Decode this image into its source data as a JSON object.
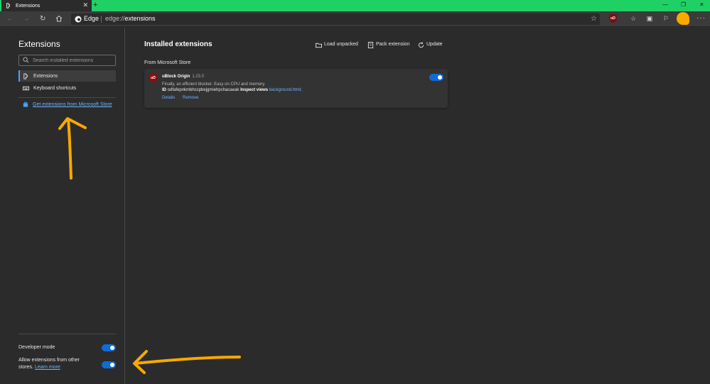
{
  "browser": {
    "tab_title": "Extensions",
    "newtab_symbol": "+",
    "close_symbol": "✕",
    "window_controls": [
      "—",
      "❐",
      "✕"
    ],
    "brand": "Edge",
    "url_scheme": "edge://",
    "url_path": "extensions",
    "more_symbol": "···",
    "ublock_badge": "uD"
  },
  "sidebar": {
    "title": "Extensions",
    "search_placeholder": "Search installed extensions",
    "items": [
      {
        "label": "Extensions",
        "active": true
      },
      {
        "label": "Keyboard shortcuts",
        "active": false
      }
    ],
    "store_link": "Get extensions from Microsoft Store",
    "developer_mode_label": "Developer mode",
    "developer_mode_on": true,
    "allow_label_line1": "Allow extensions from other",
    "allow_label_line2": "stores.",
    "learn_more": "Learn more",
    "allow_on": true
  },
  "main": {
    "title": "Installed extensions",
    "actions": [
      "Load unpacked",
      "Pack extension",
      "Update"
    ],
    "section_label": "From Microsoft Store",
    "extensions": [
      {
        "icon_text": "uD",
        "name": "uBlock Origin",
        "version": "1.23.0",
        "description": "Finally, an efficient blocker. Easy on CPU and memory.",
        "id_label": "ID",
        "id_value": "odfafepnkmbhccpbejgmiehpchacaeak",
        "inspect_label": "Inspect views",
        "inspect_link": "background.html;",
        "details": "Details",
        "remove": "Remove",
        "enabled": true
      }
    ]
  },
  "colors": {
    "accent_titlebar": "#1fd165",
    "toggle_blue": "#0f6cd6",
    "link_blue": "#6cb4ff",
    "annotation_orange": "#f7a900"
  }
}
